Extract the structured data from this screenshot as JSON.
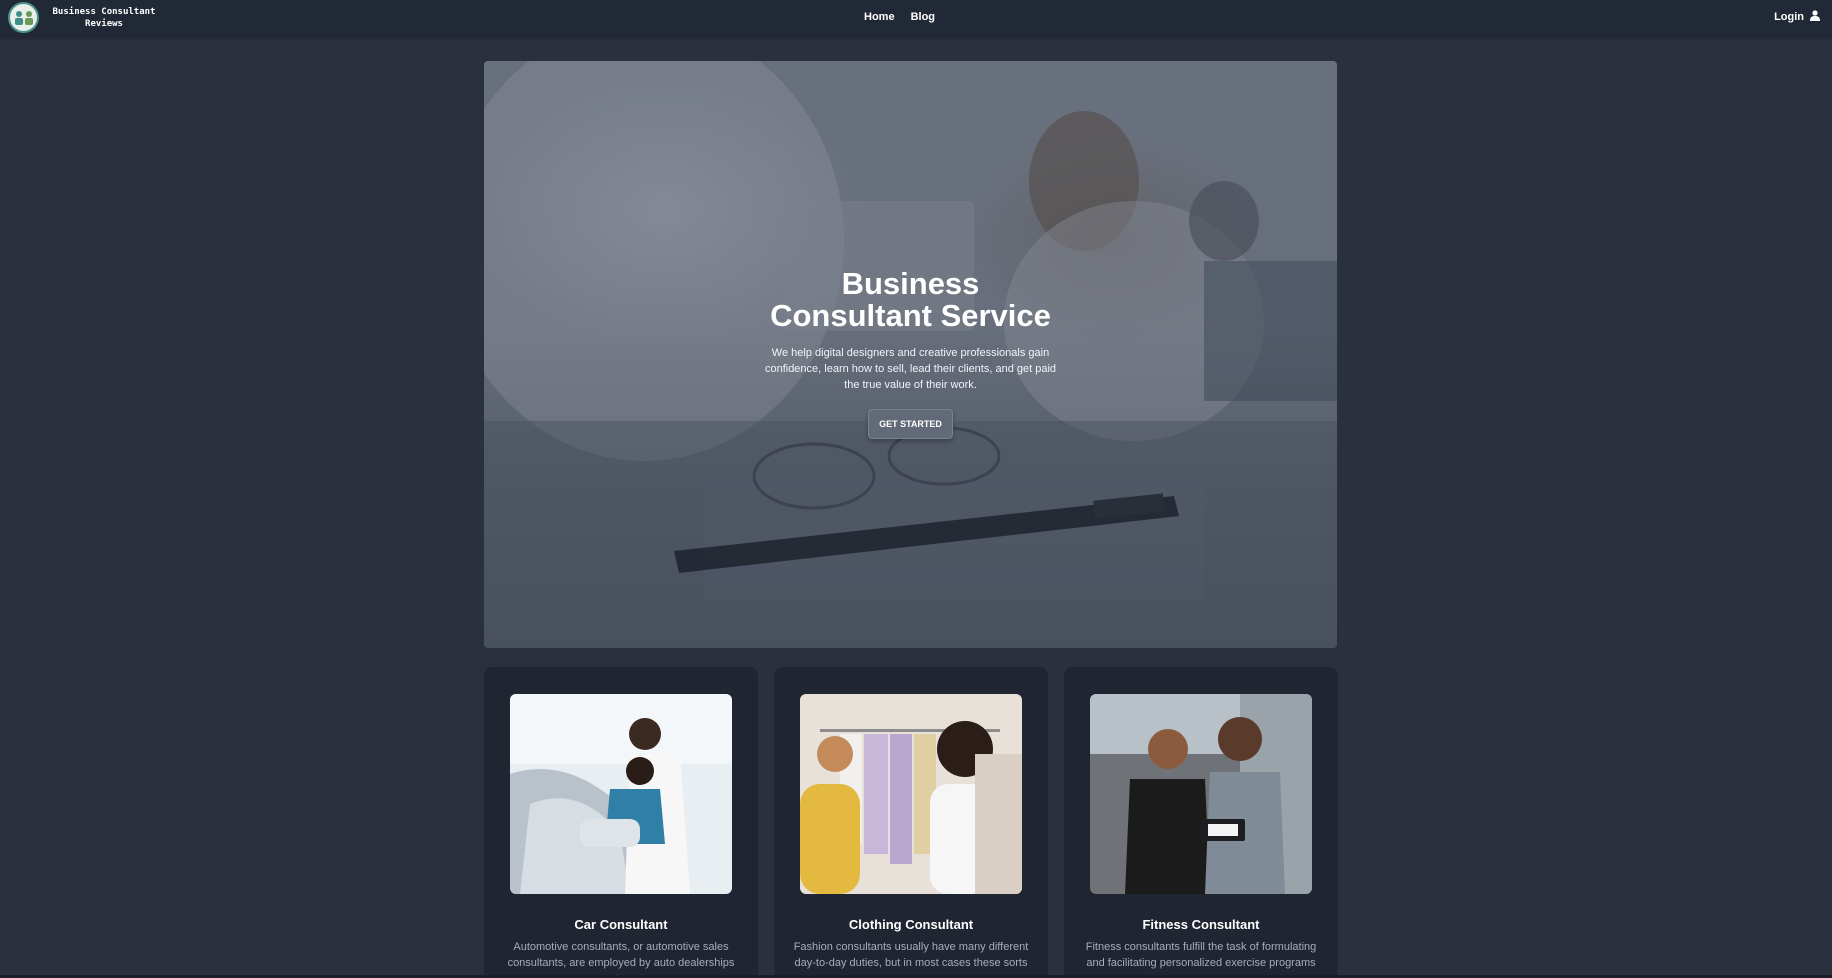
{
  "navbar": {
    "brand": "Business Consultant Reviews",
    "links": [
      "Home",
      "Blog"
    ],
    "login": "Login",
    "icons": [
      "logo-icon",
      "user-icon"
    ]
  },
  "hero": {
    "title": "Business Consultant Service",
    "description": "We help digital designers and creative professionals gain confidence, learn how to sell, lead their clients, and get paid the true value of their work.",
    "button": "GET STARTED"
  },
  "cards": [
    {
      "title": "Car Consultant",
      "description": "Automotive consultants, or automotive sales consultants, are employed by auto dealerships to"
    },
    {
      "title": "Clothing Consultant",
      "description": "Fashion consultants usually have many different day-to-day duties, but in most cases these sorts"
    },
    {
      "title": "Fitness Consultant",
      "description": "Fitness consultants fulfill the task of formulating and facilitating personalized exercise programs ..."
    }
  ],
  "colors": {
    "background": "#2a303c",
    "navbar": "#222936",
    "card": "#1f2531",
    "muted_text": "#a6adbb"
  }
}
